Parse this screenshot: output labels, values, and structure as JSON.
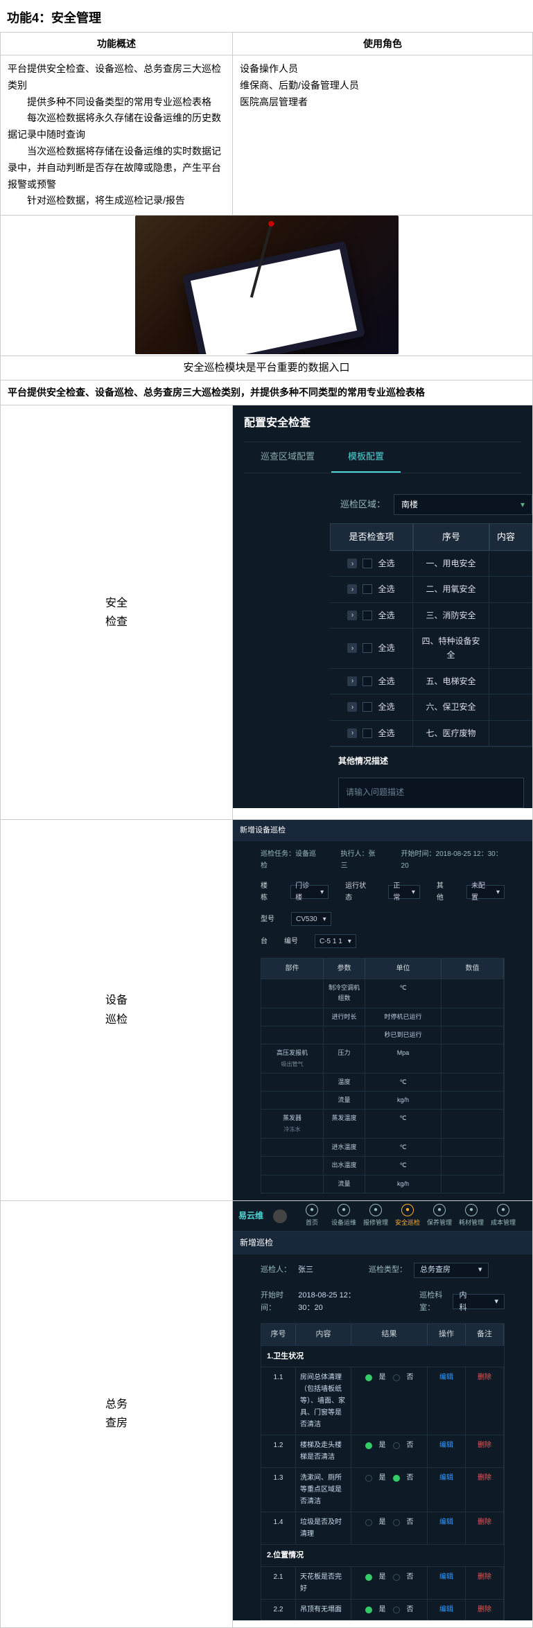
{
  "doc_title": "功能4：安全管理",
  "top_table": {
    "header_overview": "功能概述",
    "header_role": "使用角色",
    "overview_line1": "平台提供安全检查、设备巡检、总务查房三大巡检类别",
    "overview_items": [
      "提供多种不同设备类型的常用专业巡检表格",
      "每次巡检数据将永久存储在设备运维的历史数据记录中随时查询",
      "当次巡检数据将存储在设备运维的实时数据记录中，并自动判断是否存在故障或隐患，产生平台报警或预警",
      "针对巡检数据，将生成巡检记录/报告"
    ],
    "roles": [
      "设备操作人员",
      "维保商、后勤/设备管理人员",
      "医院高层管理者"
    ]
  },
  "photo_caption": "安全巡检模块是平台重要的数据入口",
  "intro_line": "平台提供安全检查、设备巡检、总务查房三大巡检类别，并提供多种不同类型的常用专业巡检表格",
  "section_labels": {
    "safety": "安全\n检查",
    "device": "设备\n巡检",
    "zw": "总务\n查房"
  },
  "safety": {
    "app_title": "配置安全检查",
    "tabs": [
      "巡查区域配置",
      "模板配置"
    ],
    "active_tab": 1,
    "area_label": "巡检区域：",
    "area_value": "南楼",
    "table_head": {
      "chk": "是否检查项",
      "no": "序号",
      "content": "内容"
    },
    "select_all": "全选",
    "rows": [
      {
        "no": "一、用电安全"
      },
      {
        "no": "二、用氧安全"
      },
      {
        "no": "三、消防安全"
      },
      {
        "no": "四、特种设备安全"
      },
      {
        "no": "五、电梯安全"
      },
      {
        "no": "六、保卫安全"
      },
      {
        "no": "七、医疗废物"
      }
    ],
    "other_title": "其他情况描述",
    "other_placeholder": "请输入问题描述"
  },
  "device": {
    "app_title": "新增设备巡检",
    "meta": {
      "task_label": "巡检任务：",
      "task_value": "设备巡检",
      "person_label": "执行人：",
      "person_value": "张三",
      "time_label": "开始时间：",
      "time_value": "2018-08-25  12：30：20"
    },
    "selects": {
      "building_label": "楼栋",
      "building_value": "门诊楼",
      "status_label": "运行状态",
      "status_value": "正常",
      "extra_label": "其他",
      "extra_value": "未配置",
      "model_label": "型号",
      "model_value": "CV530",
      "unit_label": "台",
      "unit_sub": "编号",
      "unit_value": "C-5 1 1"
    },
    "table_head": {
      "part": "部件",
      "param": "参数",
      "unit": "单位",
      "val": "数值"
    },
    "rows": [
      {
        "part": "",
        "param": "制冷空调机组数",
        "unit": "℃",
        "val": ""
      },
      {
        "part": "",
        "param": "进行时长",
        "unit": "时停机已运行",
        "val": ""
      },
      {
        "part": "",
        "param": "",
        "unit": "秒已到已运行",
        "val": ""
      },
      {
        "part": "高压发报机",
        "sub": "吸出管气",
        "param": "压力",
        "unit": "Mpa",
        "val": ""
      },
      {
        "part": "",
        "sub": "",
        "param": "温度",
        "unit": "℃",
        "val": ""
      },
      {
        "part": "",
        "sub": "",
        "param": "流量",
        "unit": "kg/h",
        "val": ""
      },
      {
        "part": "蒸发器",
        "sub": "冷冻水",
        "param": "蒸发温度",
        "unit": "℃",
        "val": ""
      },
      {
        "part": "",
        "sub": "",
        "param": "进水温度",
        "unit": "℃",
        "val": ""
      },
      {
        "part": "",
        "sub": "",
        "param": "出水温度",
        "unit": "℃",
        "val": ""
      },
      {
        "part": "",
        "sub": "",
        "param": "流量",
        "unit": "kg/h",
        "val": ""
      }
    ]
  },
  "nav": {
    "logo": "易云维",
    "items": [
      "首页",
      "设备运维",
      "报修管理",
      "安全巡检",
      "保养管理",
      "耗材管理",
      "成本管理"
    ],
    "active": 3
  },
  "zw": {
    "app_title": "新增巡检",
    "person_label": "巡检人：",
    "person_value": "张三",
    "time_label": "开始时间：",
    "time_value": "2018-08-25  12：30：20",
    "type_label": "巡检类型：",
    "type_value": "总务查房",
    "dept_label": "巡检科室：",
    "dept_value": "内科",
    "table_head": {
      "no": "序号",
      "content": "内容",
      "result": "结果",
      "op": "操作",
      "note": "备注"
    },
    "yes": "是",
    "no": "否",
    "edit_label": "编辑",
    "del_label": "删除",
    "sections": [
      {
        "title": "1.卫生状况",
        "rows": [
          {
            "no": "1.1",
            "content": "房间总体清理（包括墙板纸等）、墙面、家具、门窗等是否清洁",
            "result": "是"
          },
          {
            "no": "1.2",
            "content": "楼梯及走头楼梯是否清洁",
            "result": "是"
          },
          {
            "no": "1.3",
            "content": "洗漱间、厕所等重点区域是否清洁",
            "result": "否"
          },
          {
            "no": "1.4",
            "content": "垃圾是否及时清理",
            "result": ""
          }
        ]
      },
      {
        "title": "2.位置情况",
        "rows": [
          {
            "no": "2.1",
            "content": "天花板是否完好",
            "result": "是"
          },
          {
            "no": "2.2",
            "content": "吊顶有无塌面",
            "result": "是"
          }
        ]
      }
    ]
  }
}
